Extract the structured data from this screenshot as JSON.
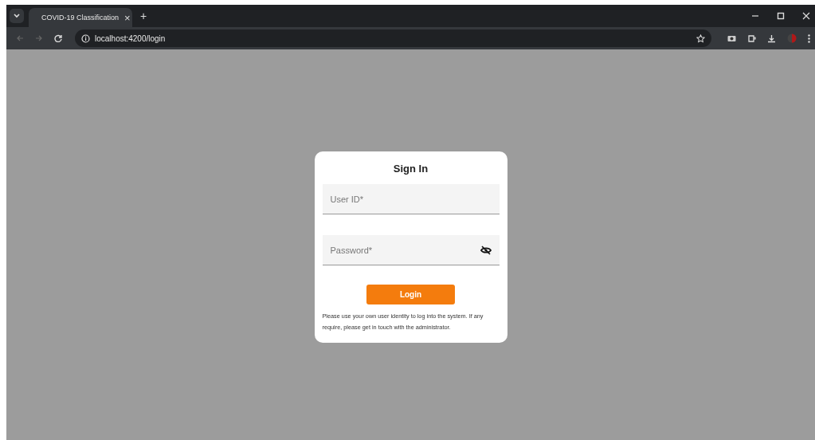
{
  "browser": {
    "tab_title": "COVID-19 Classification",
    "tab_close": "×",
    "new_tab": "+",
    "url": "localhost:4200/login"
  },
  "login": {
    "title": "Sign In",
    "fields": [
      {
        "kind": "text",
        "placeholder": "User ID*"
      },
      {
        "kind": "password",
        "placeholder": "Password*"
      }
    ],
    "button": "Login",
    "note": "Please use your own user identity to log into the system. If any require, please get in touch with the administrator."
  }
}
